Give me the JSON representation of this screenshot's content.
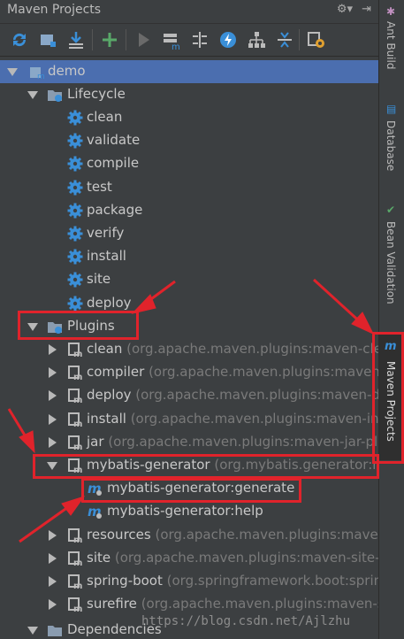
{
  "window": {
    "title": "Maven Projects"
  },
  "right_tabs": [
    {
      "label": "Ant Build"
    },
    {
      "label": "Database"
    },
    {
      "label": "Bean Validation"
    },
    {
      "label": "Maven Projects"
    }
  ],
  "tree": {
    "root": "demo",
    "lifecycle": {
      "label": "Lifecycle",
      "phases": [
        "clean",
        "validate",
        "compile",
        "test",
        "package",
        "verify",
        "install",
        "site",
        "deploy"
      ]
    },
    "plugins": {
      "label": "Plugins",
      "items": [
        {
          "name": "clean",
          "detail": "(org.apache.maven.plugins:maven-clean"
        },
        {
          "name": "compiler",
          "detail": "(org.apache.maven.plugins:maven-c"
        },
        {
          "name": "deploy",
          "detail": "(org.apache.maven.plugins:maven-dep"
        },
        {
          "name": "install",
          "detail": "(org.apache.maven.plugins:maven-insta"
        },
        {
          "name": "jar",
          "detail": "(org.apache.maven.plugins:maven-jar-plug"
        },
        {
          "name": "mybatis-generator",
          "detail": "(org.mybatis.generator:my"
        }
      ],
      "goals": [
        "mybatis-generator:generate",
        "mybatis-generator:help"
      ],
      "items_after": [
        {
          "name": "resources",
          "detail": "(org.apache.maven.plugins:maven-"
        },
        {
          "name": "site",
          "detail": "(org.apache.maven.plugins:maven-site-pl"
        },
        {
          "name": "spring-boot",
          "detail": "(org.springframework.boot:sprin"
        },
        {
          "name": "surefire",
          "detail": "(org.apache.maven.plugins:maven-su"
        }
      ]
    },
    "dependencies": {
      "label": "Dependencies"
    }
  },
  "watermark": "https://blog.csdn.net/Ajlzhu",
  "colors": {
    "annotation": "#e0232b",
    "selection": "#4b6eaf"
  }
}
